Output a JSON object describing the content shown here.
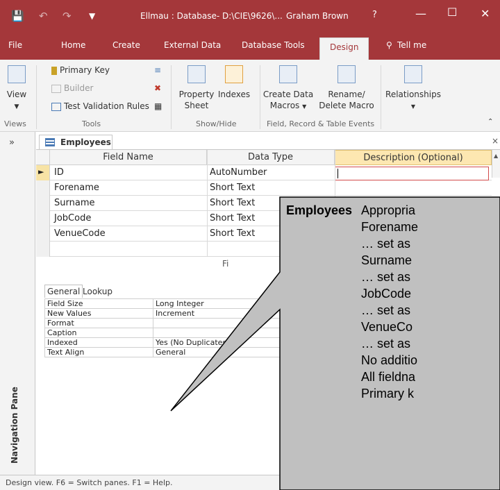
{
  "titlebar": {
    "title": "Ellmau : Database- D:\\CIE\\9626\\...",
    "user": "Graham Brown",
    "help": "?"
  },
  "tabs": [
    "File",
    "Home",
    "Create",
    "External Data",
    "Database Tools",
    "Design",
    "Tell me"
  ],
  "ribbon": {
    "view": "View",
    "primary_key": "Primary Key",
    "builder": "Builder",
    "test_validation": "Test Validation Rules",
    "property_sheet_1": "Property",
    "property_sheet_2": "Sheet",
    "indexes": "Indexes",
    "create_data_1": "Create Data",
    "create_data_2": "Macros",
    "rename_1": "Rename/",
    "rename_2": "Delete Macro",
    "relationships": "Relationships",
    "groups": [
      "Views",
      "Tools",
      "Show/Hide",
      "Field, Record & Table Events"
    ]
  },
  "nav": {
    "label": "Navigation Pane",
    "collapse": "»"
  },
  "doc": {
    "tab": "Employees",
    "close": "×"
  },
  "grid": {
    "headers": [
      "Field Name",
      "Data Type",
      "Description (Optional)"
    ],
    "rows": [
      {
        "name": "ID",
        "type": "AutoNumber"
      },
      {
        "name": "Forename",
        "type": "Short Text"
      },
      {
        "name": "Surname",
        "type": "Short Text"
      },
      {
        "name": "JobCode",
        "type": "Short Text"
      },
      {
        "name": "VenueCode",
        "type": "Short Text"
      }
    ]
  },
  "field_props": {
    "label": "Fi",
    "tabs": [
      "General",
      "Lookup"
    ],
    "rows": [
      {
        "k": "Field Size",
        "v": "Long Integer"
      },
      {
        "k": "New Values",
        "v": "Increment"
      },
      {
        "k": "Format",
        "v": ""
      },
      {
        "k": "Caption",
        "v": ""
      },
      {
        "k": "Indexed",
        "v": "Yes (No Duplicates)"
      },
      {
        "k": "Text Align",
        "v": "General"
      }
    ]
  },
  "status": "Design view.  F6 = Switch panes.  F1 = Help.",
  "callout": {
    "title": "Employees",
    "lines": [
      "Appropria",
      "Forename",
      "… set as",
      "Surname",
      "… set as",
      "JobCode",
      "… set as",
      "VenueCo",
      "… set as",
      "No additio",
      "All fieldna",
      "Primary k"
    ]
  },
  "colors": {
    "accent": "#a4373a",
    "callout_fill": "#c0c0c0"
  }
}
